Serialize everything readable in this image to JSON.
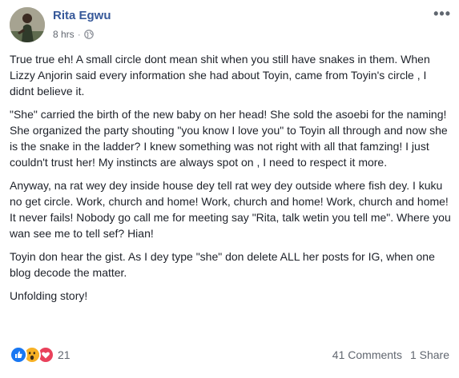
{
  "post": {
    "author": "Rita Egwu",
    "time": "8 hrs",
    "separator": "·",
    "more_label": "•••",
    "paragraphs": [
      "True true eh! A small circle dont mean shit when you still have snakes in them. When Lizzy Anjorin said every information she had about Toyin, came from Toyin's circle , I didnt believe it.",
      "\"She\" carried the birth of the new baby on her head! She sold the asoebi for the naming! She organized the party shouting \"you know I love you\" to Toyin all through and now she is the snake in the ladder? I knew something was not right with all that famzing! I just couldn't trust her! My instincts are always spot on , I need to respect it more.",
      "Anyway, na rat wey dey inside house dey tell rat wey dey outside where fish dey. I kuku no get circle. Work, church and home! Work, church and home! Work, church and home! It never fails! Nobody go call me for meeting say \"Rita, talk wetin you tell me\". Where you wan see me to tell sef? Hian!",
      "Toyin don hear the gist. As I dey type \"she\" don delete ALL her posts for IG, when one blog decode the matter.",
      "Unfolding story!"
    ]
  },
  "footer": {
    "reaction_count": "21",
    "comments": "41 Comments",
    "shares": "1 Share",
    "reactions": [
      "like-icon",
      "wow-icon",
      "love-icon"
    ]
  },
  "colors": {
    "author": "#365899",
    "like": "#1877f2",
    "wow": "#f7b125",
    "love": "#e9415b"
  }
}
